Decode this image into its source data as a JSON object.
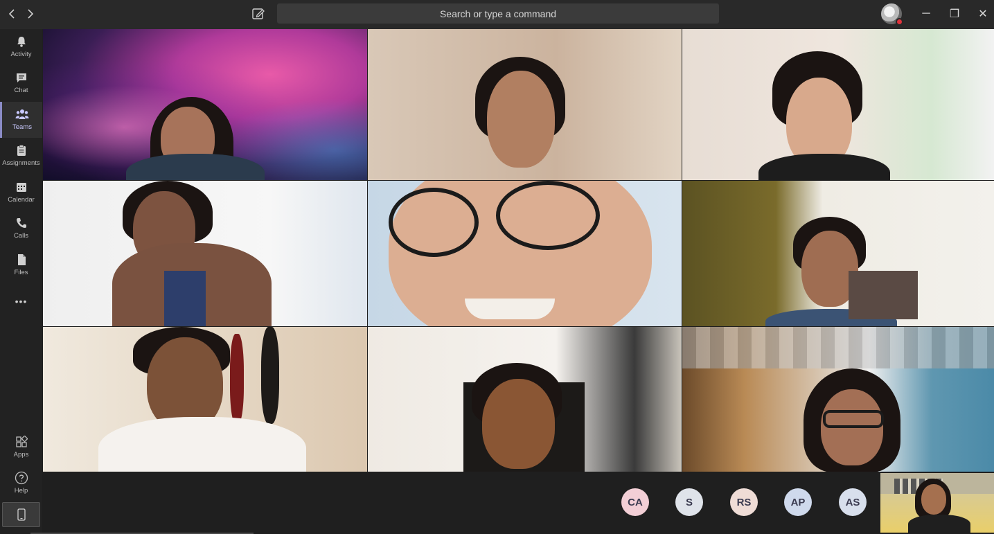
{
  "titlebar": {
    "search_placeholder": "Search or type a command",
    "back_icon": "chevron-left-icon",
    "forward_icon": "chevron-right-icon",
    "compose_icon": "compose-icon",
    "minimize": "─",
    "restore": "❐",
    "close": "✕"
  },
  "rail": {
    "items": [
      {
        "label": "Activity",
        "icon": "bell-icon"
      },
      {
        "label": "Chat",
        "icon": "chat-icon"
      },
      {
        "label": "Teams",
        "icon": "teams-icon",
        "active": true
      },
      {
        "label": "Assignments",
        "icon": "assignments-icon"
      },
      {
        "label": "Calendar",
        "icon": "calendar-icon"
      },
      {
        "label": "Calls",
        "icon": "phone-icon"
      },
      {
        "label": "Files",
        "icon": "files-icon"
      },
      {
        "label": "•••",
        "icon": "more-icon"
      }
    ],
    "bottom_items": [
      {
        "label": "Apps",
        "icon": "apps-icon"
      },
      {
        "label": "Help",
        "icon": "help-icon"
      }
    ]
  },
  "participants": [
    {
      "initials": "CA",
      "color": "#f3cfd6"
    },
    {
      "initials": "S",
      "color": "#dfe3ea"
    },
    {
      "initials": "RS",
      "color": "#efdcd6"
    },
    {
      "initials": "AP",
      "color": "#cfd9ec"
    },
    {
      "initials": "AS",
      "color": "#d8dfec"
    }
  ],
  "colors": {
    "accent": "#8b8cc7",
    "titlebar": "#292929",
    "rail": "#222222",
    "presence_busy": "#e0333c"
  }
}
